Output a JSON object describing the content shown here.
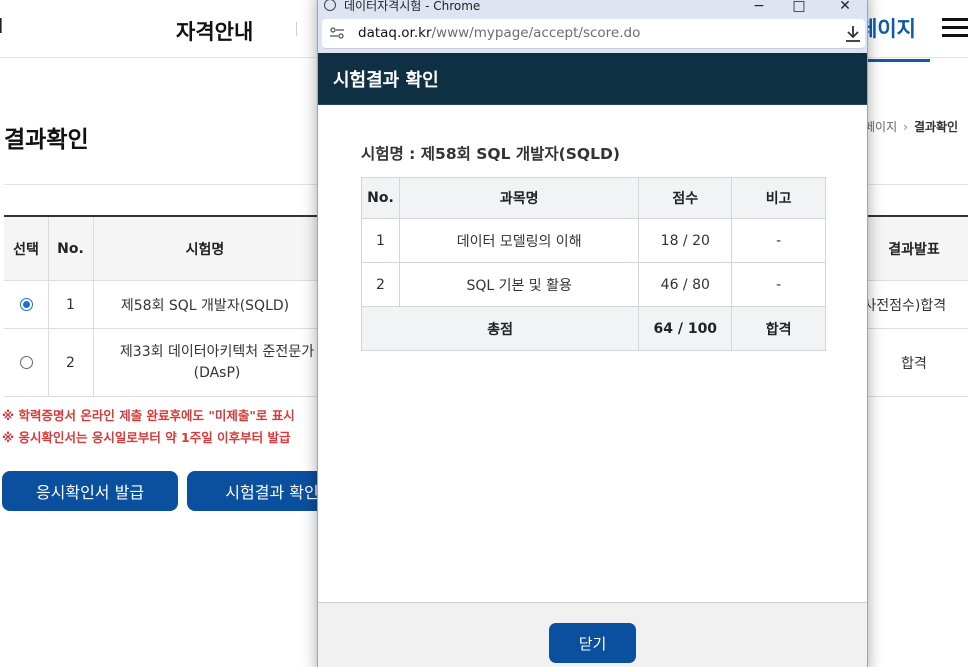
{
  "bg": {
    "logo_fragment": "Ⅰ",
    "nav_item": "자격안내",
    "nav_active": "페이지",
    "page_title": "결과확인",
    "breadcrumb": {
      "parent": "페이지",
      "current": "결과확인"
    },
    "table": {
      "headers": [
        "선택",
        "No.",
        "시험명",
        "결과발표"
      ],
      "rows": [
        {
          "no": "1",
          "name": "제58회 SQL 개발자(SQLD)",
          "result": "(사전점수)합격"
        },
        {
          "no": "2",
          "name": "제33회 데이터아키텍처 준전문가 (DAsP)",
          "result": "합격"
        }
      ]
    },
    "notices": [
      "※ 학력증명서 온라인 제출 완료후에도 \"미제출\"로 표시",
      "※ 응시확인서는 응시일로부터 약 1주일 이후부터 발급"
    ],
    "buttons": {
      "certificate": "응시확인서 발급",
      "result": "시험결과 확인"
    }
  },
  "window": {
    "title": "데이터자격시험 - Chrome",
    "url_domain": "dataq.or.kr",
    "url_path": "/www/mypage/accept/score.do",
    "controls": {
      "minimize": "−",
      "maximize": "□",
      "close": "✕"
    }
  },
  "popup": {
    "header": "시험결과 확인",
    "exam_name": "시험명 : 제58회 SQL 개발자(SQLD)",
    "columns": [
      "No.",
      "과목명",
      "점수",
      "비고"
    ],
    "rows": [
      {
        "no": "1",
        "subject": "데이터 모델링의 이해",
        "score": "18 / 20",
        "note": "-"
      },
      {
        "no": "2",
        "subject": "SQL 기본 및 활용",
        "score": "46 / 80",
        "note": "-"
      }
    ],
    "total": {
      "label": "총점",
      "score": "64 / 100",
      "result": "합격"
    },
    "close_label": "닫기"
  }
}
